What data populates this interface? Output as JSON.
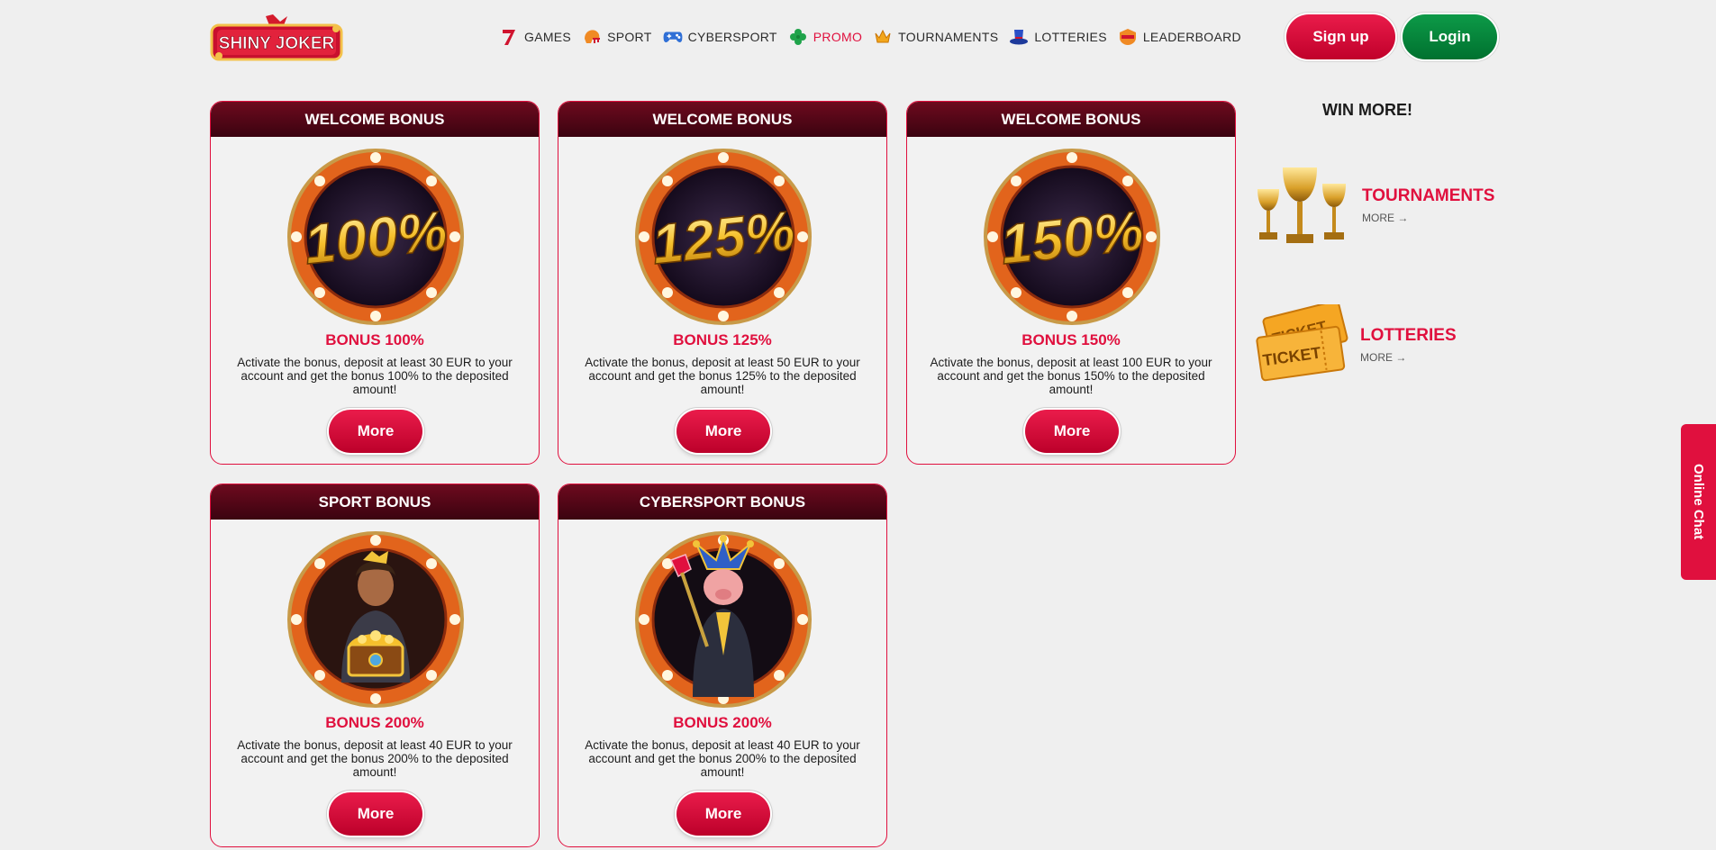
{
  "brand": {
    "logo_text": "SHINY JOKER"
  },
  "nav": [
    {
      "label": "GAMES",
      "icon": "seven-icon"
    },
    {
      "label": "SPORT",
      "icon": "football-helmet-icon"
    },
    {
      "label": "CYBERSPORT",
      "icon": "gamepad-icon"
    },
    {
      "label": "PROMO",
      "icon": "clover-icon",
      "active": true
    },
    {
      "label": "TOURNAMENTS",
      "icon": "crown-icon"
    },
    {
      "label": "LOTTERIES",
      "icon": "top-hat-icon"
    },
    {
      "label": "LEADERBOARD",
      "icon": "badge-icon"
    }
  ],
  "auth": {
    "signup_label": "Sign up",
    "login_label": "Login"
  },
  "colors": {
    "accent": "#e0103e",
    "login": "#0d8a41",
    "card_head": "#4d0615"
  },
  "cards": [
    {
      "header": "WELCOME BONUS",
      "badge": "100%",
      "title": "BONUS 100%",
      "desc": "Activate the bonus, deposit at least 30 EUR to your account and get the bonus 100% to the deposited amount!",
      "button": "More"
    },
    {
      "header": "WELCOME BONUS",
      "badge": "125%",
      "title": "BONUS 125%",
      "desc": "Activate the bonus, deposit at least 50 EUR to your account and get the bonus 125% to the deposited amount!",
      "button": "More"
    },
    {
      "header": "WELCOME BONUS",
      "badge": "150%",
      "title": "BONUS 150%",
      "desc": "Activate the bonus, deposit at least 100 EUR to your account and get the bonus 150% to the deposited amount!",
      "button": "More"
    },
    {
      "header": "SPORT BONUS",
      "title": "BONUS 200%",
      "desc": "Activate the bonus, deposit at least 40 EUR to your account and get the bonus 200% to the deposited amount!",
      "button": "More"
    },
    {
      "header": "CYBERSPORT BONUS",
      "title": "BONUS 200%",
      "desc": "Activate the bonus, deposit at least 40 EUR to your account and get the bonus 200% to the deposited amount!",
      "button": "More"
    }
  ],
  "sidebar": {
    "title": "WIN MORE!",
    "tournaments": {
      "title": "TOURNAMENTS",
      "more": "MORE"
    },
    "lotteries": {
      "title": "LOTTERIES",
      "more": "MORE",
      "ticket_text": "TICKET"
    }
  },
  "chat": {
    "label": "Online Chat"
  }
}
